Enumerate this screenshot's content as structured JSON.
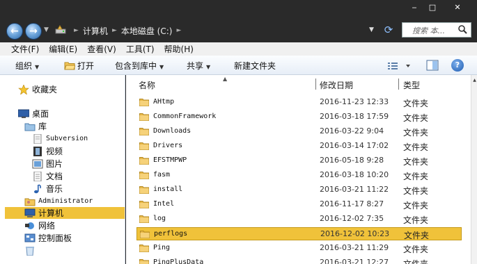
{
  "window": {
    "minimize_label": "‒",
    "maximize_label": "□",
    "close_label": "✕"
  },
  "address": {
    "crumbs": [
      "计算机",
      "本地磁盘 (C:)"
    ],
    "search_placeholder": "搜索 本..."
  },
  "menu": {
    "items": [
      "文件(F)",
      "编辑(E)",
      "查看(V)",
      "工具(T)",
      "帮助(H)"
    ]
  },
  "toolbar": {
    "organize": "组织",
    "open": "打开",
    "include_in_library": "包含到库中",
    "share": "共享",
    "new_folder": "新建文件夹",
    "help": "?"
  },
  "nav": {
    "favorites": "收藏夹",
    "desktop": "桌面",
    "libraries": "库",
    "subversion": "Subversion",
    "videos": "视频",
    "pictures": "图片",
    "documents": "文档",
    "music": "音乐",
    "administrator": "Administrator",
    "computer": "计算机",
    "network": "网络",
    "control_panel": "控制面板"
  },
  "columns": {
    "name": "名称",
    "modified": "修改日期",
    "type": "类型"
  },
  "files": [
    {
      "name": "AHtmp",
      "date": "2016-11-23 12:33",
      "type": "文件夹"
    },
    {
      "name": "CommonFramework",
      "date": "2016-03-18 17:59",
      "type": "文件夹"
    },
    {
      "name": "Downloads",
      "date": "2016-03-22 9:04",
      "type": "文件夹"
    },
    {
      "name": "Drivers",
      "date": "2016-03-14 17:02",
      "type": "文件夹"
    },
    {
      "name": "EFSTMPWP",
      "date": "2016-05-18 9:28",
      "type": "文件夹"
    },
    {
      "name": "fasm",
      "date": "2016-03-18 10:20",
      "type": "文件夹"
    },
    {
      "name": "install",
      "date": "2016-03-21 11:22",
      "type": "文件夹"
    },
    {
      "name": "Intel",
      "date": "2016-11-17 8:27",
      "type": "文件夹"
    },
    {
      "name": "log",
      "date": "2016-12-02 7:35",
      "type": "文件夹"
    },
    {
      "name": "perflogs",
      "date": "2016-12-02 10:23",
      "type": "文件夹"
    },
    {
      "name": "Ping",
      "date": "2016-03-21 11:29",
      "type": "文件夹"
    },
    {
      "name": "PingPlusData",
      "date": "2016-03-21 12:27",
      "type": "文件夹"
    }
  ],
  "selected_file_index": 9,
  "colors": {
    "selection": "#f0c23a",
    "titlebar": "#2a2a2a",
    "folder": "#e8b84a"
  }
}
